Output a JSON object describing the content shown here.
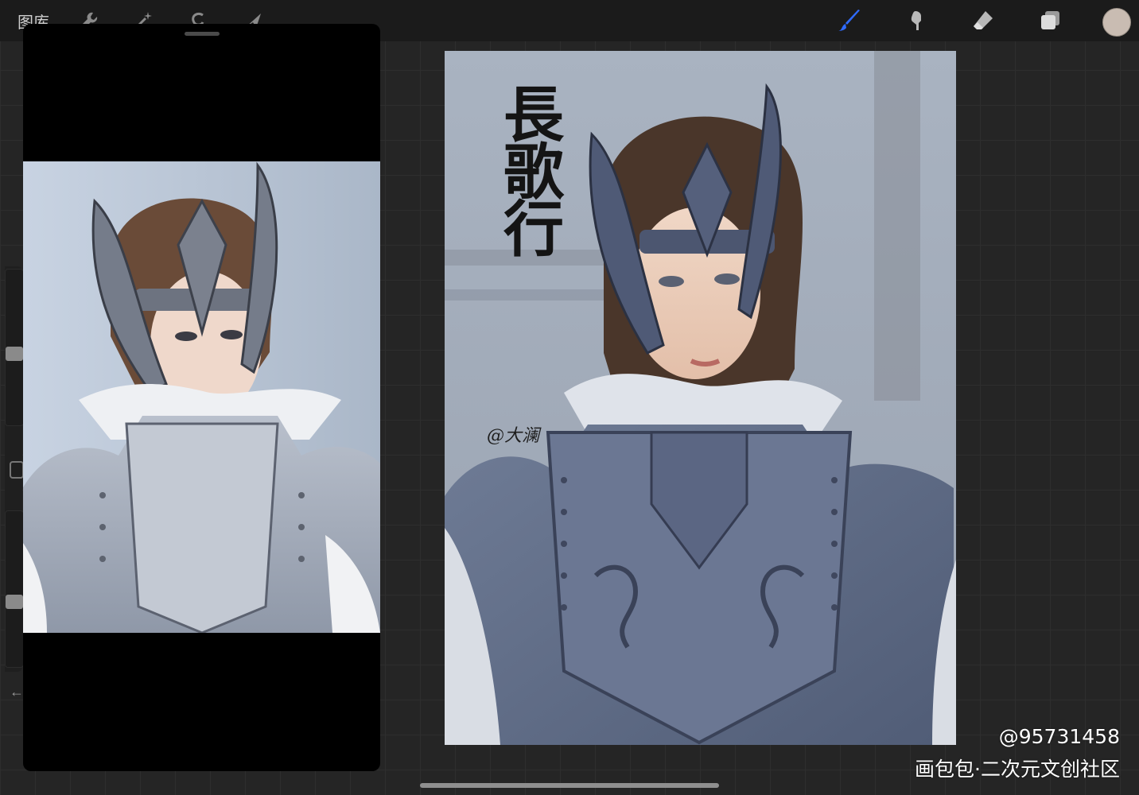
{
  "toolbar": {
    "gallery_label": "图库",
    "left_tools": [
      "wrench-icon",
      "magic-wand-icon",
      "selection-icon",
      "transform-arrow-icon"
    ],
    "right_tools": [
      "brush-icon",
      "smudge-icon",
      "eraser-icon",
      "layers-icon"
    ],
    "active_tool": "brush-icon",
    "accent_color": "#2f6bff",
    "current_color": "#c9bcb2"
  },
  "canvas": {
    "title_text": "長歌行",
    "signature_text": "@大澜"
  },
  "watermark": {
    "line1": "@95731458",
    "line2": "画包包·二次元文创社区"
  }
}
